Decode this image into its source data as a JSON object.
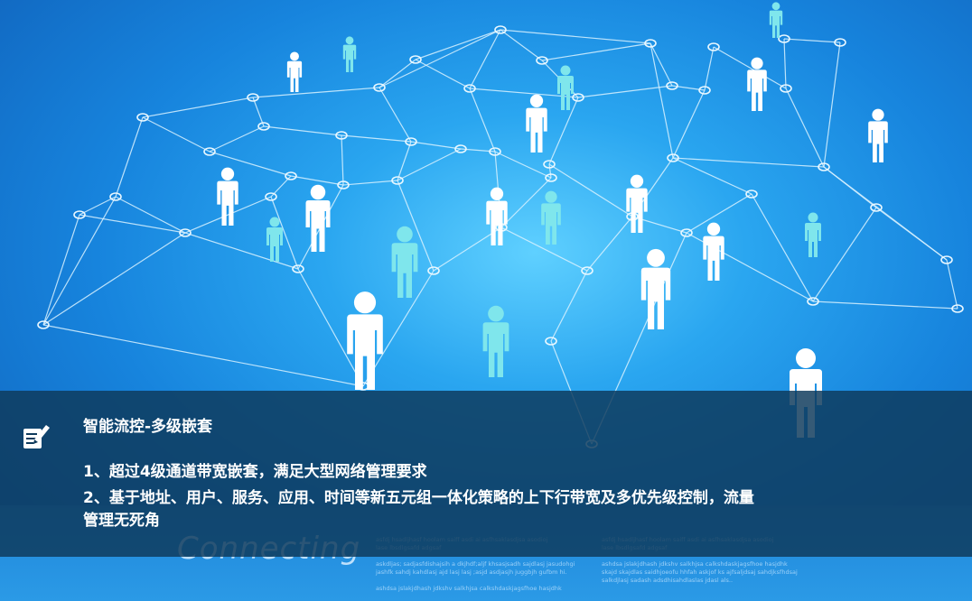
{
  "background": {
    "connect_word": "Connecting",
    "accent_colors": {
      "sky": "#1a86dc",
      "panel": "#0e3a5c",
      "person_white": "#ffffff",
      "person_cyan": "#7fe6ec"
    }
  },
  "panel": {
    "icon": "note-edit-icon",
    "title": "智能流控-多级嵌套",
    "line1": "1、超过4级通道带宽嵌套，满足大型网络管理要求",
    "line2a": "2、基于地址、用户、服务、应用、时间等新五元组一体化策略的上下行带宽及多优先级控制，流量",
    "line2b": "管理无死角"
  }
}
